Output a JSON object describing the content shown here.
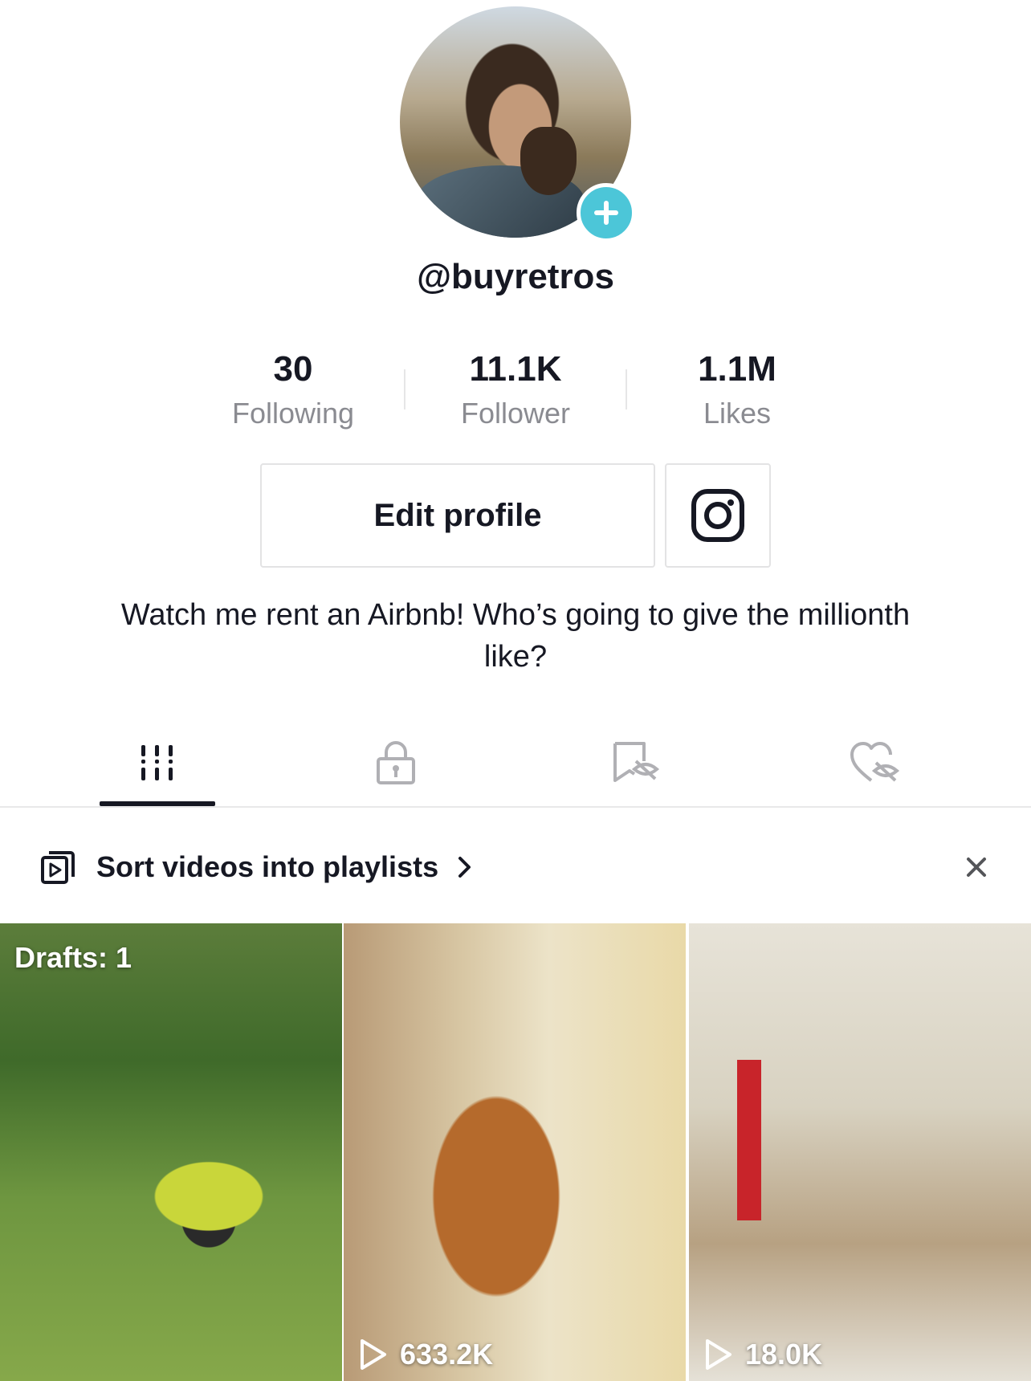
{
  "profile": {
    "username": "@buyretros",
    "bio": "Watch me rent an Airbnb!  Who’s going to give the millionth like?"
  },
  "stats": [
    {
      "value": "30",
      "label": "Following"
    },
    {
      "value": "11.1K",
      "label": "Follower"
    },
    {
      "value": "1.1M",
      "label": "Likes"
    }
  ],
  "buttons": {
    "edit_profile": "Edit profile"
  },
  "tabs": [
    {
      "icon": "grid-icon",
      "active": true
    },
    {
      "icon": "lock-icon",
      "active": false
    },
    {
      "icon": "bookmark-hidden-icon",
      "active": false
    },
    {
      "icon": "heart-hidden-icon",
      "active": false
    }
  ],
  "banner": {
    "text": "Sort videos into playlists"
  },
  "videos": [
    {
      "label": "Drafts: 1"
    },
    {
      "views": "633.2K"
    },
    {
      "views": "18.0K"
    }
  ],
  "colors": {
    "accent": "#4cc6d8",
    "text": "#161823",
    "muted": "#8a8b91"
  }
}
